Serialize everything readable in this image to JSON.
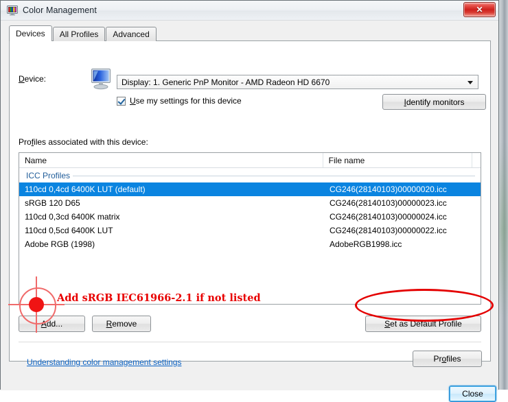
{
  "window": {
    "title": "Color Management",
    "icon": "color-monitor-icon",
    "close_label": "✕"
  },
  "tabs": [
    {
      "label": "Devices",
      "active": true
    },
    {
      "label": "All Profiles",
      "active": false
    },
    {
      "label": "Advanced",
      "active": false
    }
  ],
  "device": {
    "label": "Device:",
    "icon": "monitor-icon",
    "selected": "Display: 1. Generic PnP Monitor - AMD Radeon HD 6670",
    "checkbox_label": "Use my settings for this device",
    "checkbox_checked": true,
    "identify_button": "Identify monitors"
  },
  "profiles": {
    "section_label": "Profiles associated with this device:",
    "columns": [
      "Name",
      "File name"
    ],
    "group_label": "ICC Profiles",
    "rows": [
      {
        "name": "110cd 0,4cd 6400K LUT (default)",
        "file": "CG246(28140103)00000020.icc",
        "selected": true
      },
      {
        "name": "sRGB 120 D65",
        "file": "CG246(28140103)00000023.icc",
        "selected": false
      },
      {
        "name": "110cd 0,3cd  6400K matrix",
        "file": "CG246(28140103)00000024.icc",
        "selected": false
      },
      {
        "name": "110cd 0,5cd  6400K LUT",
        "file": "CG246(28140103)00000022.icc",
        "selected": false
      },
      {
        "name": "Adobe RGB (1998)",
        "file": "AdobeRGB1998.icc",
        "selected": false
      }
    ],
    "add_button": "Add...",
    "remove_button": "Remove",
    "set_default_button": "Set as Default Profile"
  },
  "footer": {
    "link": "Understanding color management settings",
    "profiles_button": "Profiles",
    "close_button": "Close"
  },
  "annotations": {
    "note_text": "Add sRGB IEC61966-2.1 if not listed",
    "note_color": "#e80000",
    "highlight_color": "#e40000",
    "crosshair_color": "#f01414"
  },
  "colors": {
    "selection_blue": "#0a84e0",
    "link_blue": "#0b63c5",
    "group_blue": "#1f5c99"
  }
}
